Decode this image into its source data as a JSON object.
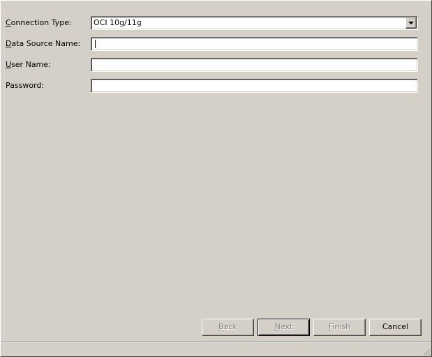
{
  "form": {
    "connection_type": {
      "label": "Connection Type:",
      "accel": "C",
      "rest": "onnection Type:",
      "value": "OCI 10g/11g"
    },
    "data_source_name": {
      "label": "Data Source Name:",
      "accel": "D",
      "rest": "ata Source Name:",
      "value": ""
    },
    "user_name": {
      "label": "User Name:",
      "accel": "U",
      "rest": "ser Name:",
      "value": ""
    },
    "password": {
      "label": "Password:",
      "value": ""
    }
  },
  "buttons": {
    "back": {
      "label": "Back",
      "accel": "B",
      "rest": "ack",
      "enabled": false
    },
    "next": {
      "label": "Next",
      "accel": "N",
      "rest": "ext",
      "enabled": false
    },
    "finish": {
      "label": "Finish",
      "accel": "F",
      "rest": "inish",
      "enabled": false
    },
    "cancel": {
      "label": "Cancel",
      "enabled": true
    }
  },
  "icons": {
    "dropdown": "chevron-down-icon",
    "resize": "resize-grip-icon"
  }
}
